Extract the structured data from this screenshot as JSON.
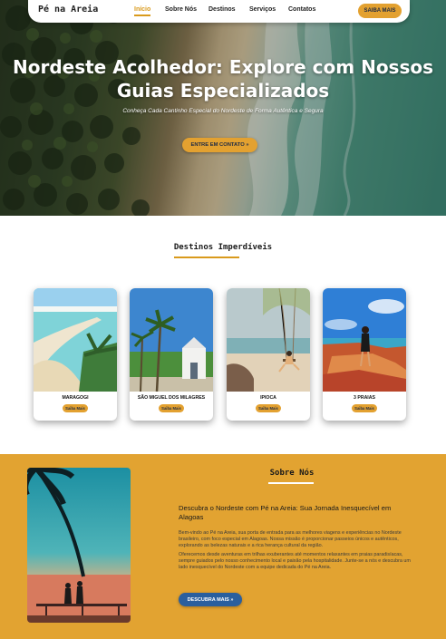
{
  "brand": {
    "logo": "Pé na Areia",
    "accent_color": "#e3a130",
    "secondary_color": "#2a5f9e"
  },
  "nav": {
    "items": [
      {
        "label": "Início",
        "active": true
      },
      {
        "label": "Sobre Nós",
        "active": false
      },
      {
        "label": "Destinos",
        "active": false
      },
      {
        "label": "Serviços",
        "active": false
      },
      {
        "label": "Contatos",
        "active": false
      }
    ],
    "cta_label": "SAIBA MAIS"
  },
  "hero": {
    "title_line1": "Nordeste Acolhedor: Explore com Nossos",
    "title_line2": "Guias Especializados",
    "subtitle": "Conheça Cada Cantinho Especial do Nordeste de Forma Autêntica e Segura",
    "cta_label": "ENTRE EM CONTATO »"
  },
  "destinos": {
    "title": "Destinos Imperdíveis",
    "cards": [
      {
        "name": "MARAGOGI",
        "button": "Saiba Mais",
        "image": "beach-sandbar-palms"
      },
      {
        "name": "SÃO MIGUEL DOS MILAGRES",
        "button": "Saiba Mais",
        "image": "chapel-palms"
      },
      {
        "name": "IPIOCA",
        "button": "Saiba Mais",
        "image": "beach-swing"
      },
      {
        "name": "3 PRAIAS",
        "button": "Saiba Mais",
        "image": "red-cliffs-woman"
      }
    ]
  },
  "sobre": {
    "title": "Sobre Nós",
    "heading": "Descubra o Nordeste com Pé na Areia: Sua Jornada Inesquecível em Alagoas",
    "paragraph1": "Bem-vindo ao Pé na Areia, sua porta de entrada para as melhores viagens e experiências no Nordeste brasileiro, com foco especial em Alagoas. Nossa missão é proporcionar passeios únicos e autênticos, explorando as belezas naturais e a rica herança cultural da região.",
    "paragraph2": "Oferecemos desde aventuras em trilhas exuberantes até momentos relaxantes em praias paradisíacas, sempre guiados pelo nosso conhecimento local e paixão pela hospitalidade. Junte-se a nós e descubra um lado inesquecível do Nordeste com a equipe dedicada do Pé na Areia.",
    "cta_label": "DESCUBRA MAIS »",
    "image": "couple-palm-sunset"
  }
}
